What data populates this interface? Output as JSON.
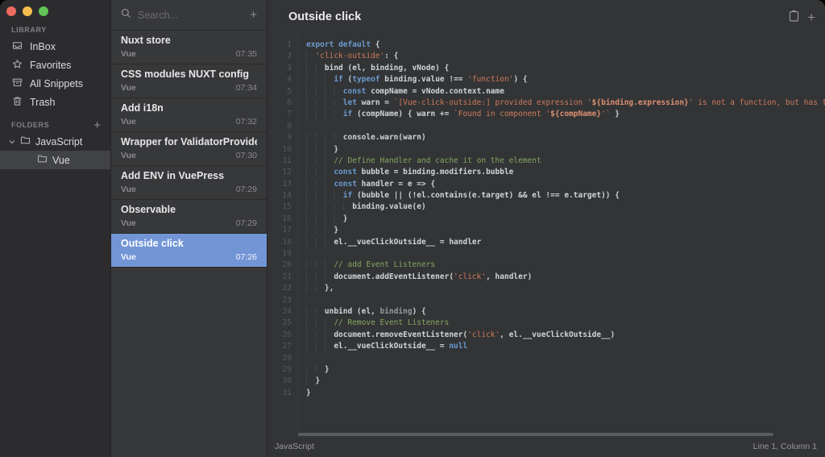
{
  "window": {
    "buttons": [
      "close",
      "minimize",
      "zoom"
    ]
  },
  "sidebar": {
    "library_label": "LIBRARY",
    "library_items": [
      {
        "icon": "inbox-icon",
        "label": "InBox"
      },
      {
        "icon": "star-icon",
        "label": "Favorites"
      },
      {
        "icon": "archive-icon",
        "label": "All Snippets"
      },
      {
        "icon": "trash-icon",
        "label": "Trash"
      }
    ],
    "folders_label": "FOLDERS",
    "add_folder_label": "+",
    "folders": [
      {
        "label": "JavaScript",
        "nested": false,
        "expanded": true,
        "selected": false
      },
      {
        "label": "Vue",
        "nested": true,
        "expanded": false,
        "selected": true
      }
    ]
  },
  "snippet_list": {
    "search_placeholder": "Search...",
    "add_snippet_label": "+",
    "items": [
      {
        "title": "Nuxt store",
        "tag": "Vue",
        "time": "07:35",
        "selected": false
      },
      {
        "title": "CSS modules NUXT config",
        "tag": "Vue",
        "time": "07:34",
        "selected": false
      },
      {
        "title": "Add i18n",
        "tag": "Vue",
        "time": "07:32",
        "selected": false
      },
      {
        "title": "Wrapper for ValidatorProvider",
        "tag": "Vue",
        "time": "07:30",
        "selected": false
      },
      {
        "title": "Add ENV in VuePress",
        "tag": "Vue",
        "time": "07:29",
        "selected": false
      },
      {
        "title": "Observable",
        "tag": "Vue",
        "time": "07:29",
        "selected": false
      },
      {
        "title": "Outside click",
        "tag": "Vue",
        "time": "07:26",
        "selected": true
      }
    ]
  },
  "editor": {
    "title": "Outside click",
    "actions": [
      {
        "icon": "clipboard-icon"
      },
      {
        "icon": "plus-icon",
        "label": "+"
      }
    ],
    "language": "JavaScript",
    "cursor_position": "Line 1, Column 1",
    "code_lines": [
      {
        "indent": 0,
        "tokens": [
          [
            "k",
            "export"
          ],
          [
            "p",
            " "
          ],
          [
            "k",
            "default"
          ],
          [
            "p",
            " {"
          ]
        ]
      },
      {
        "indent": 2,
        "tokens": [
          [
            "s",
            "'click-outside'"
          ],
          [
            "p",
            ": {"
          ]
        ]
      },
      {
        "indent": 4,
        "tokens": [
          [
            "p",
            "bind (el, binding, vNode) {"
          ]
        ]
      },
      {
        "indent": 6,
        "tokens": [
          [
            "k",
            "if"
          ],
          [
            "p",
            " ("
          ],
          [
            "k",
            "typeof"
          ],
          [
            "p",
            " binding.value !== "
          ],
          [
            "s",
            "'function'"
          ],
          [
            "p",
            ") {"
          ]
        ]
      },
      {
        "indent": 8,
        "tokens": [
          [
            "k",
            "const"
          ],
          [
            "p",
            " compName = vNode.context.name"
          ]
        ]
      },
      {
        "indent": 8,
        "tokens": [
          [
            "k",
            "let"
          ],
          [
            "p",
            " warn = "
          ],
          [
            "s",
            "`[Vue-click-outside:] provided expression '"
          ],
          [
            "x",
            "${binding.expression}"
          ],
          [
            "s",
            "' is not a function, but has to be`"
          ]
        ]
      },
      {
        "indent": 8,
        "tokens": [
          [
            "k",
            "if"
          ],
          [
            "p",
            " (compName) { warn += "
          ],
          [
            "s",
            "`Found in component '"
          ],
          [
            "x",
            "${compName}"
          ],
          [
            "s",
            "'`"
          ],
          [
            "p",
            " }"
          ]
        ]
      },
      {
        "indent": 0,
        "tokens": []
      },
      {
        "indent": 8,
        "tokens": [
          [
            "p",
            "console.warn(warn)"
          ]
        ]
      },
      {
        "indent": 6,
        "tokens": [
          [
            "p",
            "}"
          ]
        ]
      },
      {
        "indent": 6,
        "tokens": [
          [
            "c",
            "// Define Handler and cache it on the element"
          ]
        ]
      },
      {
        "indent": 6,
        "tokens": [
          [
            "k",
            "const"
          ],
          [
            "p",
            " bubble = binding.modifiers.bubble"
          ]
        ]
      },
      {
        "indent": 6,
        "tokens": [
          [
            "k",
            "const"
          ],
          [
            "p",
            " handler = e => {"
          ]
        ]
      },
      {
        "indent": 8,
        "tokens": [
          [
            "k",
            "if"
          ],
          [
            "p",
            " (bubble || (!el.contains(e.target) && el !== e.target)) {"
          ]
        ]
      },
      {
        "indent": 10,
        "tokens": [
          [
            "p",
            "binding.value(e)"
          ]
        ]
      },
      {
        "indent": 8,
        "tokens": [
          [
            "p",
            "}"
          ]
        ]
      },
      {
        "indent": 6,
        "tokens": [
          [
            "p",
            "}"
          ]
        ]
      },
      {
        "indent": 6,
        "tokens": [
          [
            "p",
            "el.__vueClickOutside__ = handler"
          ]
        ]
      },
      {
        "indent": 0,
        "tokens": []
      },
      {
        "indent": 6,
        "tokens": [
          [
            "c",
            "// add Event Listeners"
          ]
        ]
      },
      {
        "indent": 6,
        "tokens": [
          [
            "p",
            "document.addEventListener("
          ],
          [
            "s",
            "'click'"
          ],
          [
            "p",
            ", handler)"
          ]
        ]
      },
      {
        "indent": 4,
        "tokens": [
          [
            "p",
            "},"
          ]
        ]
      },
      {
        "indent": 0,
        "tokens": []
      },
      {
        "indent": 4,
        "tokens": [
          [
            "p",
            "unbind (el, "
          ],
          [
            "d",
            "binding"
          ],
          [
            "p",
            ") {"
          ]
        ]
      },
      {
        "indent": 6,
        "tokens": [
          [
            "c",
            "// Remove Event Listeners"
          ]
        ]
      },
      {
        "indent": 6,
        "tokens": [
          [
            "p",
            "document.removeEventListener("
          ],
          [
            "s",
            "'click'"
          ],
          [
            "p",
            ", el.__vueClickOutside__)"
          ]
        ]
      },
      {
        "indent": 6,
        "tokens": [
          [
            "p",
            "el.__vueClickOutside__ = "
          ],
          [
            "k",
            "null"
          ]
        ]
      },
      {
        "indent": 0,
        "tokens": []
      },
      {
        "indent": 4,
        "tokens": [
          [
            "p",
            "}"
          ]
        ]
      },
      {
        "indent": 2,
        "tokens": [
          [
            "p",
            "}"
          ]
        ]
      },
      {
        "indent": 0,
        "tokens": [
          [
            "p",
            "}"
          ]
        ]
      }
    ]
  },
  "colors": {
    "accent_selection": "#7295d6",
    "keyword": "#6a9bcf",
    "string": "#cf7a5a",
    "interpolation": "#dc9070",
    "comment": "#85a75f",
    "plain_text": "#d0d4d8",
    "sidebar_bg": "#2c2c2e",
    "list_bg": "#373839",
    "editor_bg": "#333436",
    "traffic_close": "#ed6a5e",
    "traffic_min": "#f5bf4f",
    "traffic_zoom": "#61c454"
  }
}
